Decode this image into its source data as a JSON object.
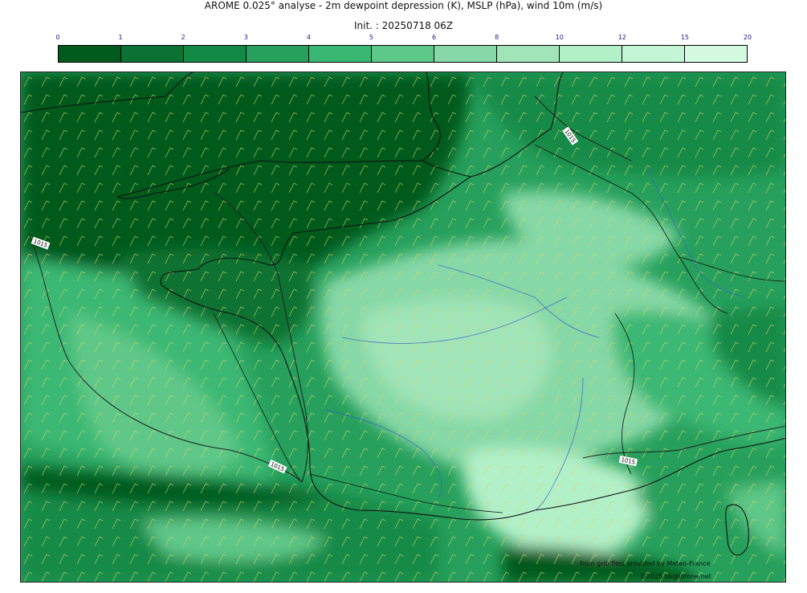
{
  "header": {
    "title": "AROME 0.025° analyse - 2m dewpoint depression (K), MSLP (hPa), wind 10m (m/s)",
    "init": "Init. : 20250718 06Z"
  },
  "colorbar": {
    "ticks": [
      "0",
      "1",
      "2",
      "3",
      "4",
      "5",
      "6",
      "8",
      "10",
      "12",
      "15",
      "20"
    ],
    "colors": [
      "#005a1c",
      "#0a7233",
      "#128a46",
      "#26a05c",
      "#3ab873",
      "#5ec888",
      "#86d8a6",
      "#a0e4b8",
      "#b2f0c8",
      "#c2f6d4",
      "#d4fbe2"
    ]
  },
  "map": {
    "isobar_labels": [
      "1015",
      "1015",
      "1015",
      "1015"
    ]
  },
  "credits": {
    "data": "from grib files provided by Meteo-France",
    "copyright": "©2025 sb@infone.net"
  }
}
